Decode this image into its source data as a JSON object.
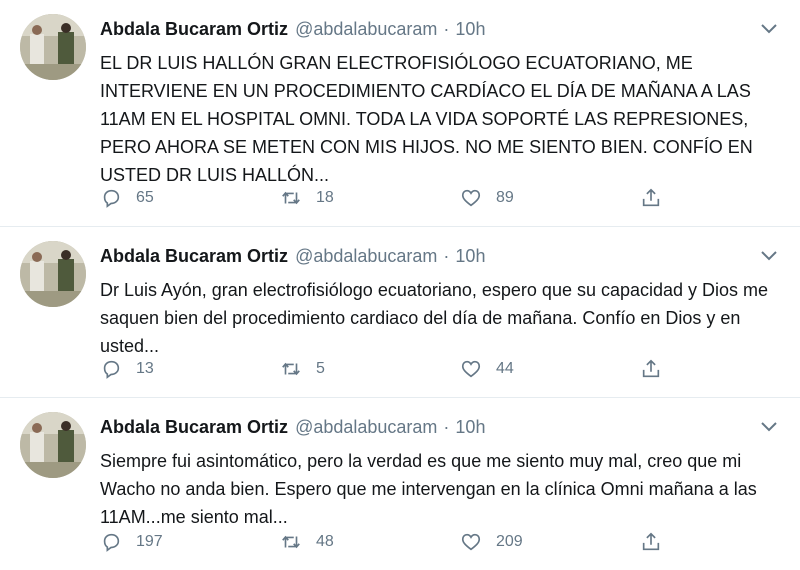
{
  "tweets": [
    {
      "name": "Abdala Bucaram Ortiz",
      "handle": "@abdalabucaram",
      "separator": "·",
      "time": "10h",
      "text": "EL DR LUIS HALLÓN GRAN ELECTROFISIÓLOGO ECUATORIANO, ME INTERVIENE EN UN PROCEDIMIENTO CARDÍACO EL DÍA DE MAÑANA A LAS 11AM EN EL HOSPITAL OMNI. TODA LA VIDA SOPORTÉ LAS REPRESIONES, PERO AHORA SE METEN CON MIS HIJOS. NO ME SIENTO BIEN. CONFÍO EN USTED DR LUIS HALLÓN...",
      "replies": "65",
      "retweets": "18",
      "likes": "89"
    },
    {
      "name": "Abdala Bucaram Ortiz",
      "handle": "@abdalabucaram",
      "separator": "·",
      "time": "10h",
      "text": "Dr Luis Ayón, gran electrofisiólogo ecuatoriano, espero que su capacidad y Dios me saquen bien del procedimiento cardiaco del día de mañana. Confío en Dios y en usted...",
      "replies": "13",
      "retweets": "5",
      "likes": "44"
    },
    {
      "name": "Abdala Bucaram Ortiz",
      "handle": "@abdalabucaram",
      "separator": "·",
      "time": "10h",
      "text": "Siempre fui asintomático, pero la verdad es que me siento muy mal, creo que mi Wacho no anda bien. Espero que me intervengan en la clínica Omni mañana a las 11AM...me siento mal...",
      "replies": "197",
      "retweets": "48",
      "likes": "209"
    }
  ],
  "icons": {
    "reply": "reply-icon",
    "retweet": "retweet-icon",
    "like": "heart-icon",
    "share": "share-icon",
    "menu": "chevron-down-icon"
  },
  "colors": {
    "text": "#14171a",
    "muted": "#657786",
    "divider": "#e6ecf0"
  }
}
